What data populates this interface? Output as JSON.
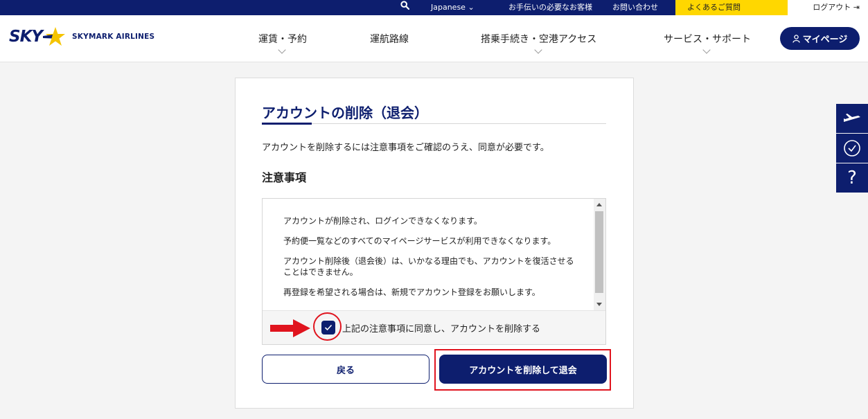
{
  "topbar": {
    "language": "Japanese",
    "help": "お手伝いの必要なお客様",
    "contact": "お問い合わせ",
    "faq": "よくあるご質問",
    "logout": "ログアウト"
  },
  "header": {
    "logo_sky": "SKY",
    "logo_airlines": "SKYMARK AIRLINES",
    "nav": [
      "運賃・予約",
      "運航路線",
      "搭乗手続き・空港アクセス",
      "サービス・サポート"
    ],
    "mypage": "マイページ"
  },
  "side": {
    "help_glyph": "?"
  },
  "main": {
    "title": "アカウントの削除（退会）",
    "intro": "アカウントを削除するには注意事項をご確認のうえ、同意が必要です。",
    "section_title": "注意事項",
    "notices": [
      "アカウントが削除され、ログインできなくなります。",
      "予約便一覧などのすべてのマイページサービスが利用できなくなります。",
      "アカウント削除後（退会後）は、いかなる理由でも、アカウントを復活させることはできません。",
      "再登録を希望される場合は、新規でアカウント登録をお願いします。"
    ],
    "agree_label": "上記の注意事項に同意し、アカウントを削除する",
    "agree_checked": true,
    "back_button": "戻る",
    "delete_button": "アカウントを削除して退会"
  },
  "colors": {
    "navy": "#0d1e6e",
    "yellow": "#ffd700",
    "highlight_red": "#e0141e"
  }
}
